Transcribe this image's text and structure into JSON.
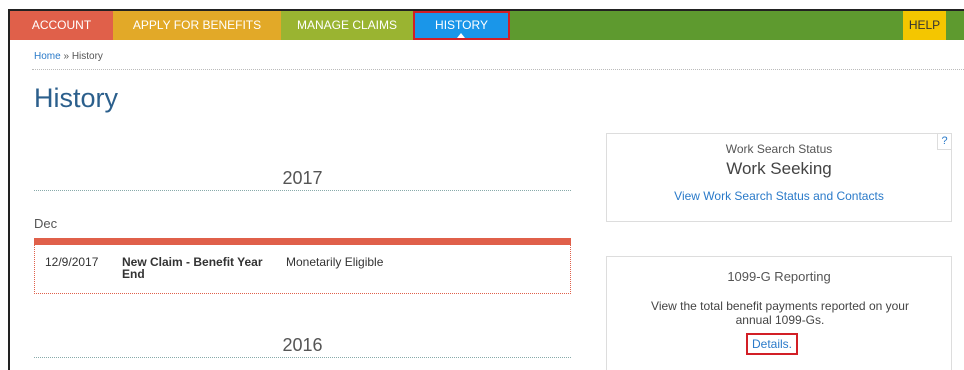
{
  "nav": {
    "account": "ACCOUNT",
    "apply": "APPLY FOR BENEFITS",
    "claims": "MANAGE CLAIMS",
    "history": "HISTORY",
    "help": "HELP"
  },
  "breadcrumb": {
    "home": "Home",
    "separator": "»",
    "current": "History"
  },
  "page_title": "History",
  "years": [
    "2017",
    "2016"
  ],
  "month": "Dec",
  "entry": {
    "date": "12/9/2017",
    "event": "New Claim - Benefit Year End",
    "status": "Monetarily Eligible"
  },
  "work_search": {
    "title": "Work Search Status",
    "status": "Work Seeking",
    "link": "View Work Search Status and Contacts",
    "help_icon": "?"
  },
  "reporting_1099g": {
    "title": "1099-G Reporting",
    "description": "View the total benefit payments reported on your annual 1099-Gs.",
    "link": "Details."
  },
  "colors": {
    "account": "#e0604a",
    "apply": "#e2a928",
    "claims": "#9ab431",
    "history": "#1a96e9",
    "help": "#f4c600",
    "nav_bg": "#5e9a2f",
    "highlight": "#d21f26",
    "link": "#2a7ac9"
  }
}
